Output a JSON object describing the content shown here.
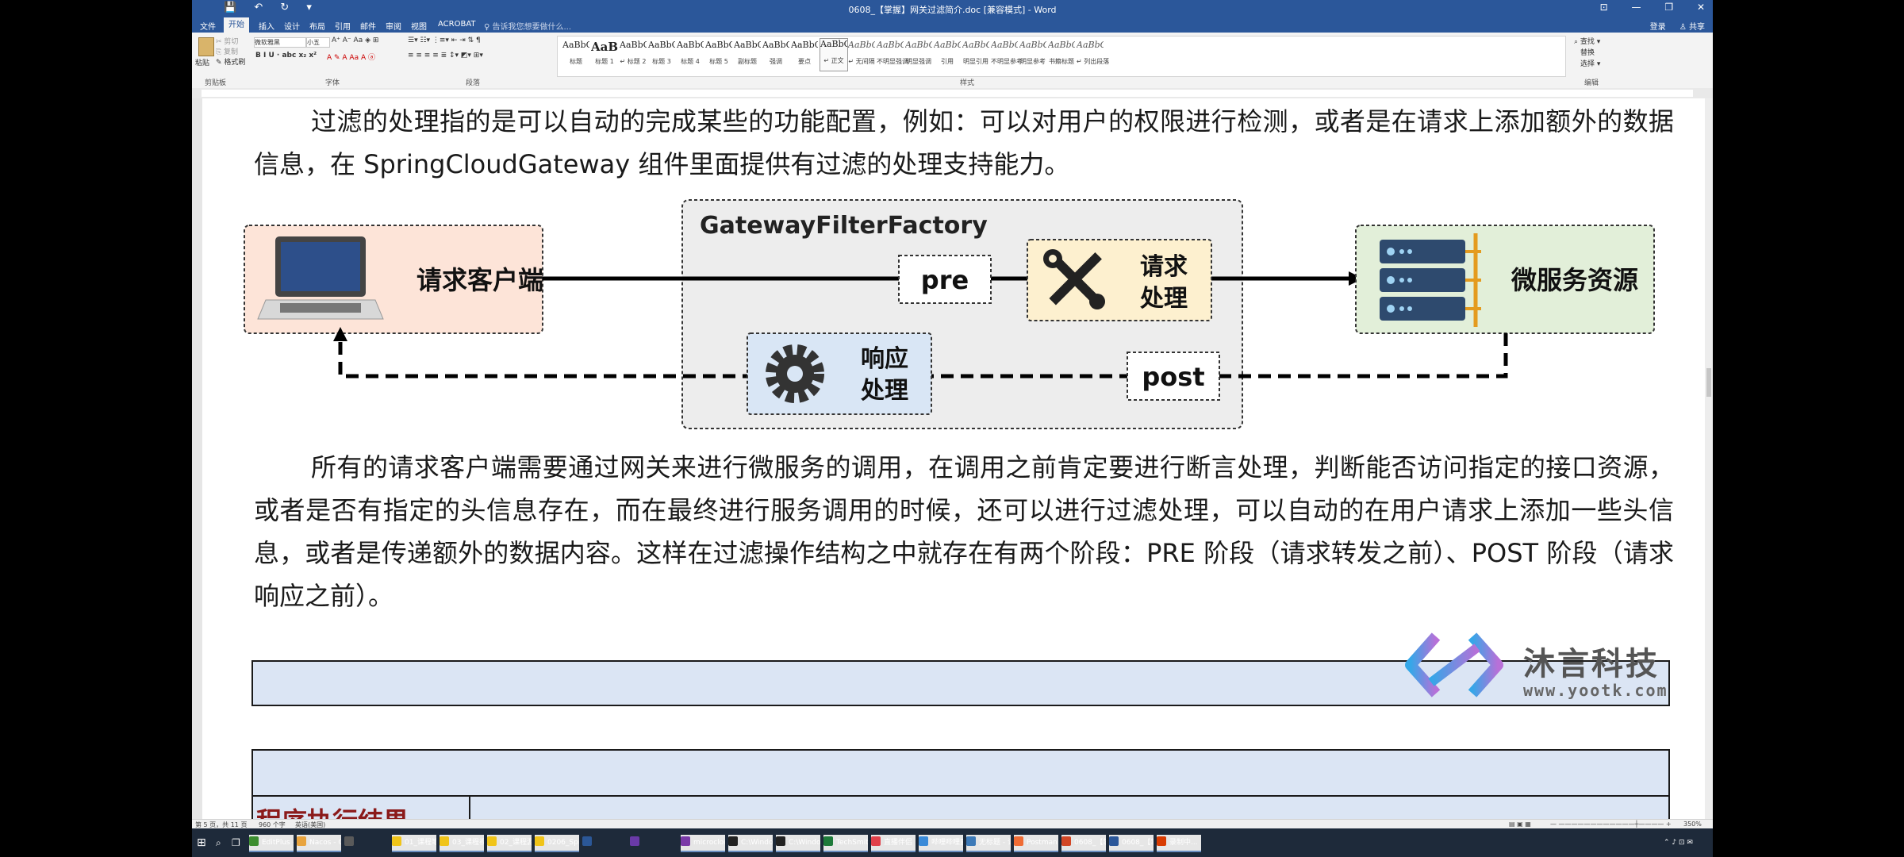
{
  "titlebar": {
    "title": "0608_【掌握】网关过滤简介.doc [兼容模式] - Word",
    "quick_access": [
      "💾",
      "↶",
      "↻",
      "▾"
    ],
    "window_controls": [
      "⊡",
      "—",
      "❐",
      "✕"
    ]
  },
  "tabs": {
    "items": [
      "文件",
      "开始",
      "插入",
      "设计",
      "布局",
      "引用",
      "邮件",
      "审阅",
      "视图",
      "ACROBAT"
    ],
    "active": "开始",
    "tell_me": "♀ 告诉我您想要做什么...",
    "login": "登录",
    "share": "♙ 共享"
  },
  "ribbon": {
    "clipboard": {
      "paste": "粘贴",
      "cut": "✂ 剪切",
      "copy": "⎘ 复制",
      "format_painter": "✎ 格式刷",
      "label": "剪贴板"
    },
    "font": {
      "name": "微软雅黑",
      "size": "小五",
      "label": "字体"
    },
    "paragraph": {
      "label": "段落"
    },
    "styles_label": "样式",
    "editing": {
      "find": "⌕ 查找 ▾",
      "replace": "替换",
      "select": "选择 ▾",
      "label": "编辑"
    },
    "styles": [
      {
        "preview": "AaBbC",
        "name": "标题"
      },
      {
        "preview": "AaBl",
        "name": "标题 1"
      },
      {
        "preview": "AaBbC",
        "name": "↵ 标题 2"
      },
      {
        "preview": "AaBbC",
        "name": "标题 3"
      },
      {
        "preview": "AaBbC",
        "name": "标题 4"
      },
      {
        "preview": "AaBbC",
        "name": "标题 5"
      },
      {
        "preview": "AaBbC",
        "name": "副标题"
      },
      {
        "preview": "AaBbCcD",
        "name": "强调"
      },
      {
        "preview": "AaBbCcD",
        "name": "要点"
      },
      {
        "preview": "AaBbCcDc",
        "name": "↵ 正文"
      },
      {
        "preview": "AaBbCcDc",
        "name": "↵ 无间隔"
      },
      {
        "preview": "AaBbCcDc",
        "name": "不明显强调"
      },
      {
        "preview": "AaBbCcDc",
        "name": "明显强调"
      },
      {
        "preview": "AaBbCcDc",
        "name": "引用"
      },
      {
        "preview": "AaBbCcDc",
        "name": "明显引用"
      },
      {
        "preview": "AaBbCcD",
        "name": "不明显参考"
      },
      {
        "preview": "AaBbCcI",
        "name": "明显参考"
      },
      {
        "preview": "AaBbCcD",
        "name": "书籍标题"
      },
      {
        "preview": "AaBbCcDc",
        "name": "↵ 列出段落"
      }
    ]
  },
  "document": {
    "para1": "过滤的处理指的是可以自动的完成某些的功能配置，例如：可以对用户的权限进行检测，或者是在请求上添加额外的数据信息，在 SpringCloudGateway 组件里面提供有过滤的处理支持能力。",
    "para2": "所有的请求客户端需要通过网关来进行微服务的调用，在调用之前肯定要进行断言处理，判断能否访问指定的接口资源，或者是否有指定的头信息存在，而在最终进行服务调用的时候，还可以进行过滤处理，可以自动的在用户请求上添加一些头信息，或者是传递额外的数据内容。这样在过滤操作结构之中就存在有两个阶段：PRE 阶段（请求转发之前）、POST 阶段（请求响应之前）。",
    "diagram": {
      "client": "请求客户端",
      "factory": "GatewayFilterFactory",
      "pre": "pre",
      "request_line1": "请求",
      "request_line2": "处理",
      "response_line1": "响应",
      "response_line2": "处理",
      "post": "post",
      "service": "微服务资源"
    },
    "table_partial_heading": "程序执行结果"
  },
  "watermark": {
    "brand": "沐言科技",
    "url": "www.yootk.com"
  },
  "statusbar": {
    "page": "第 5 页，共 11 页",
    "words": "960 个字",
    "lang": "英语(美国)",
    "zoom": "350%"
  },
  "taskbar": {
    "items": [
      "EditPlus - [...",
      "Nacos - Go...",
      "",
      "01_课程笔记",
      "03_课程视频",
      "02_课程源代...",
      "0206_Sprin...",
      "",
      "",
      "microcloud ...",
      "C:\\Windows...",
      "C:\\Windows...",
      "TechSmith ...",
      "直播伴侣",
      "哔哩哔哩直...",
      "无标题 - 记...",
      "Postman",
      "0608_【掌...",
      "0608_【掌...",
      "录制中..."
    ]
  },
  "colors": {
    "word_blue": "#2b579a",
    "client_box": "#fde4d8",
    "request_box": "#fdf0cf",
    "response_box": "#d9e6f5",
    "service_box": "#e2efd9",
    "factory_box": "#ededed"
  }
}
